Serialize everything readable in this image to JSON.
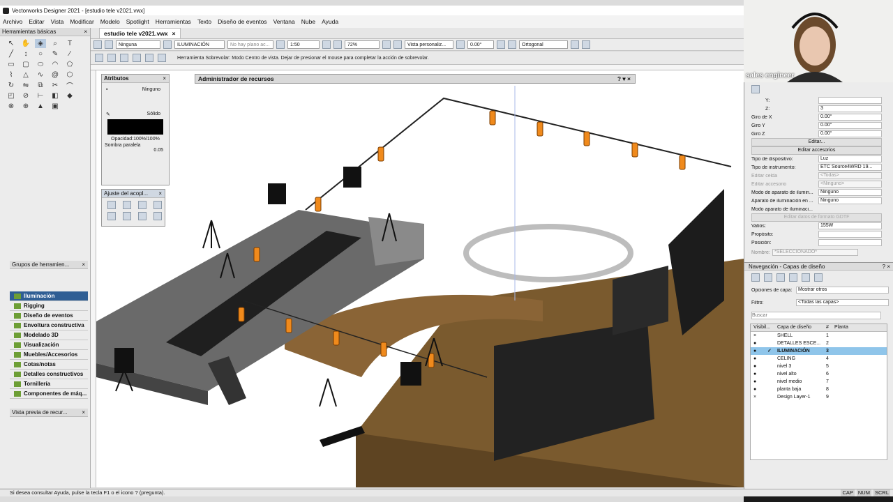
{
  "window": {
    "title": "Vectorworks Designer 2021 - [estudio tele v2021.vwx]"
  },
  "menu": [
    "Archivo",
    "Editar",
    "Vista",
    "Modificar",
    "Modelo",
    "Spotlight",
    "Herramientas",
    "Texto",
    "Diseño de eventos",
    "Ventana",
    "Nube",
    "Ayuda"
  ],
  "document_tab": {
    "label": "estudio tele v2021.vwx",
    "close": "×"
  },
  "viewbar": {
    "class": "Ninguna",
    "layer": "ILUMINACIÓN",
    "plane": "No hay plano ac...",
    "scale": "1:50",
    "zoom": "72%",
    "view": "Vista personaliz...",
    "rotation": "0.00°",
    "projection": "Ortogonal"
  },
  "mode_hint": "Herramienta Sobrevolar: Modo Centro de vista. Dejar de presionar el mouse para completar la acción de sobrevolar.",
  "left_pane": {
    "basic_tools_title": "Herramientas básicas",
    "tool_sets_title": "Grupos de herramien...",
    "tool_sets": [
      "Iluminación",
      "Rigging",
      "Diseño de eventos",
      "Envoltura constructiva",
      "Modelado 3D",
      "Visualización",
      "Muebles/Accesorios",
      "Cotas/notas",
      "Detalles constructivos",
      "Tornillería",
      "Componentes de máq..."
    ],
    "active_set": "Iluminación",
    "preview_title": "Vista previa de recur..."
  },
  "attributes_palette": {
    "title": "Atributos",
    "fill_none": "Ninguno",
    "pen_style": "Sólido",
    "opacity": "Opacidad:100%/100%",
    "shadow": "Sombra paralela",
    "thickness": "0.05"
  },
  "snap_palette": {
    "title": "Ajuste del acopl..."
  },
  "resource_manager": {
    "title": "Administrador de recursos"
  },
  "object_info": {
    "y_label": "Y:",
    "y_value": "",
    "z_label": "Z:",
    "z_value": "3",
    "rows": [
      {
        "label": "Giro de X",
        "value": "0.00°"
      },
      {
        "label": "Giro Y",
        "value": "0.00°"
      },
      {
        "label": "Giro Z",
        "value": "0.00°"
      }
    ],
    "edit_button": "Editar...",
    "edit_accessories_button": "Editar accesorios",
    "rows2": [
      {
        "label": "Tipo de dispositivo:",
        "value": "Luz"
      },
      {
        "label": "Tipo de instrumento:",
        "value": "ETC Source4WRD 19..."
      },
      {
        "label": "Editar celda",
        "value": "<Todas>"
      },
      {
        "label": "Editar accesorio",
        "value": "<Ninguno>"
      },
      {
        "label": "Modo de aparato de ilumin...",
        "value": "Ninguno"
      },
      {
        "label": "Aparato de iluminación en ...",
        "value": "Ninguno"
      },
      {
        "label": "Modo aparato de iluminaci...",
        "value": ""
      }
    ],
    "gdtf_button": "Editar datos de formato GDTF",
    "rows3": [
      {
        "label": "Vatios:",
        "value": "155W"
      },
      {
        "label": "Propósito:",
        "value": ""
      },
      {
        "label": "Posición:",
        "value": ""
      }
    ],
    "name_label": "Nombre:",
    "name_value": "*SELECCIONADO*"
  },
  "navigation": {
    "title": "Navegación - Capas de diseño",
    "layer_options_label": "Opciones de capa:",
    "layer_options_value": "Mostrar otros",
    "filter_label": "Filtro:",
    "filter_value": "<Todas las capas>",
    "search_placeholder": "Buscar",
    "columns": [
      "Visibil...",
      "Capa de diseño",
      "#",
      "Planta"
    ],
    "layers": [
      {
        "vis": "×",
        "check": "",
        "name": "SHELL",
        "num": "1"
      },
      {
        "vis": "●",
        "check": "",
        "name": "DETALLES ESCE...",
        "num": "2"
      },
      {
        "vis": "●",
        "check": "✓",
        "name": "ILUMINACIÓN",
        "num": "3"
      },
      {
        "vis": "●",
        "check": "",
        "name": "CELING",
        "num": "4"
      },
      {
        "vis": "●",
        "check": "",
        "name": "nivel 3",
        "num": "5"
      },
      {
        "vis": "●",
        "check": "",
        "name": "nivel alto",
        "num": "6"
      },
      {
        "vis": "●",
        "check": "",
        "name": "nivel medio",
        "num": "7"
      },
      {
        "vis": "●",
        "check": "",
        "name": "planta baja",
        "num": "8"
      },
      {
        "vis": "×",
        "check": "",
        "name": "Design Layer-1",
        "num": "9"
      }
    ],
    "selected_layer": "ILUMINACIÓN"
  },
  "webcam": {
    "name": "sales engineer"
  },
  "status": {
    "help": "Si desea consultar Ayuda, pulse la tecla F1 o el icono ? (pregunta).",
    "caps": "CAP",
    "num": "NUM",
    "scrl": "SCRL"
  },
  "colors": {
    "accent": "#2f5e94",
    "selection": "#8fc5ea",
    "fixture": "#f08a1c",
    "stage_gray": "#5a5a5a",
    "floor_brown": "#7a5a2e"
  }
}
